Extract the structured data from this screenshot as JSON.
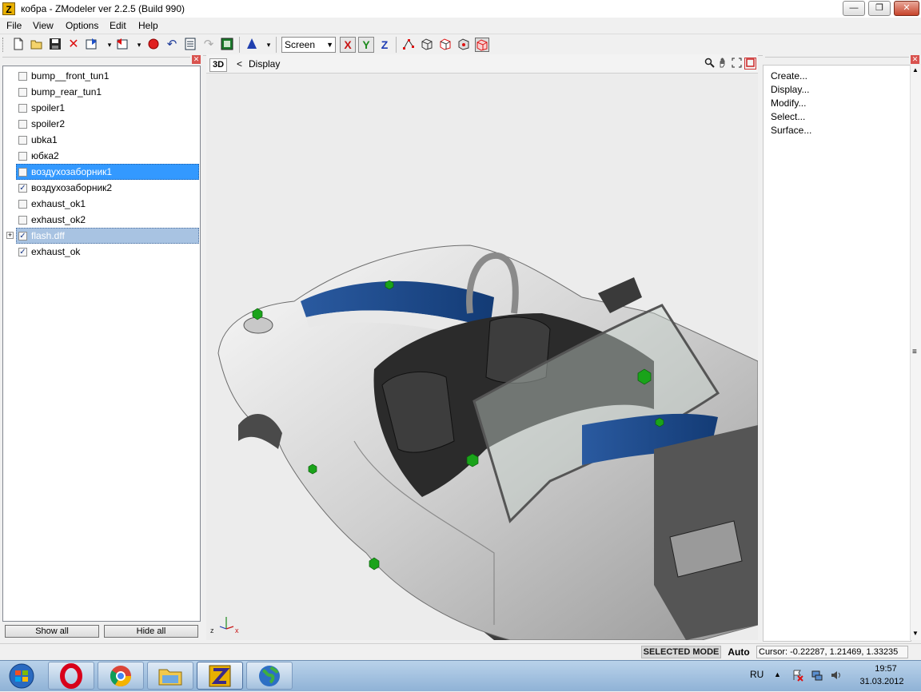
{
  "window": {
    "title": "кобра - ZModeler ver 2.2.5 (Build 990)",
    "app_icon_letter": "Z",
    "minimize": "—",
    "maximize": "❐",
    "close": "✕"
  },
  "menu": {
    "items": [
      "File",
      "View",
      "Options",
      "Edit",
      "Help"
    ]
  },
  "toolbar": {
    "view_select": "Screen",
    "axis_x": "X",
    "axis_y": "Y",
    "axis_z": "Z",
    "icons": [
      "new-icon",
      "open-icon",
      "save-icon",
      "delete-icon",
      "import-icon",
      "export-icon",
      "record-icon",
      "undo-icon",
      "properties-icon",
      "redo-icon",
      "render-icon",
      "color-icon"
    ]
  },
  "object_list": {
    "items": [
      {
        "label": "bump__front_tun1",
        "checked": false
      },
      {
        "label": "bump_rear_tun1",
        "checked": false
      },
      {
        "label": "spoiler1",
        "checked": false
      },
      {
        "label": "spoiler2",
        "checked": false
      },
      {
        "label": "ubka1",
        "checked": false
      },
      {
        "label": "юбка2",
        "checked": false
      },
      {
        "label": "воздухозаборник1",
        "checked": false,
        "selected": true
      },
      {
        "label": "воздухозаборник2",
        "checked": true
      },
      {
        "label": "exhaust_ok1",
        "checked": false
      },
      {
        "label": "exhaust_ok2",
        "checked": false
      },
      {
        "label": "flash.dff",
        "checked": true,
        "highlighted": true,
        "expandable": true
      },
      {
        "label": "exhaust_ok",
        "checked": true
      }
    ],
    "show_all_label": "Show all",
    "hide_all_label": "Hide all",
    "check_mark": "✓",
    "expand_mark": "+"
  },
  "viewport": {
    "mode_label": "3D",
    "back_label": "<",
    "title": "Display",
    "axis_gizmo": {
      "z": "z",
      "x": "x"
    },
    "icons": [
      "zoom-icon",
      "pan-icon",
      "fit-icon",
      "maximize-icon"
    ]
  },
  "right_panel": {
    "items": [
      "Create...",
      "Display...",
      "Modify...",
      "Select...",
      "Surface..."
    ]
  },
  "status": {
    "mode": "SELECTED MODE",
    "auto": "Auto",
    "cursor": "Cursor: -0.22287, 1.21469, 1.33235"
  },
  "taskbar": {
    "apps": [
      "start-button",
      "opera",
      "chrome",
      "explorer",
      "zmodeler",
      "globe"
    ],
    "language": "RU",
    "time": "19:57",
    "date": "31.03.2012"
  },
  "colors": {
    "selection": "#3399ff",
    "highlight": "#a8c3e2",
    "car_body": "#d8d8d8",
    "car_stripe": "#1e4f8f",
    "marker": "#1aa31a"
  }
}
